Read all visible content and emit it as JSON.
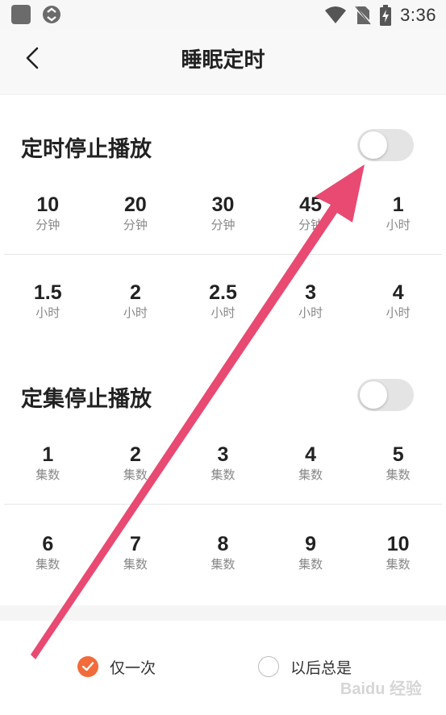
{
  "status_bar": {
    "time": "3:36"
  },
  "header": {
    "title": "睡眠定时"
  },
  "timer_section": {
    "title": "定时停止播放",
    "enabled": false,
    "rows": [
      [
        {
          "value": "10",
          "unit": "分钟"
        },
        {
          "value": "20",
          "unit": "分钟"
        },
        {
          "value": "30",
          "unit": "分钟"
        },
        {
          "value": "45",
          "unit": "分钟"
        },
        {
          "value": "1",
          "unit": "小时"
        }
      ],
      [
        {
          "value": "1.5",
          "unit": "小时"
        },
        {
          "value": "2",
          "unit": "小时"
        },
        {
          "value": "2.5",
          "unit": "小时"
        },
        {
          "value": "3",
          "unit": "小时"
        },
        {
          "value": "4",
          "unit": "小时"
        }
      ]
    ]
  },
  "episode_section": {
    "title": "定集停止播放",
    "enabled": false,
    "rows": [
      [
        {
          "value": "1",
          "unit": "集数"
        },
        {
          "value": "2",
          "unit": "集数"
        },
        {
          "value": "3",
          "unit": "集数"
        },
        {
          "value": "4",
          "unit": "集数"
        },
        {
          "value": "5",
          "unit": "集数"
        }
      ],
      [
        {
          "value": "6",
          "unit": "集数"
        },
        {
          "value": "7",
          "unit": "集数"
        },
        {
          "value": "8",
          "unit": "集数"
        },
        {
          "value": "9",
          "unit": "集数"
        },
        {
          "value": "10",
          "unit": "集数"
        }
      ]
    ]
  },
  "repeat_options": [
    {
      "label": "仅一次",
      "checked": true
    },
    {
      "label": "以后总是",
      "checked": false
    }
  ],
  "watermark": "Baidu 经验",
  "colors": {
    "accent": "#f26b3a",
    "annotation_arrow": "#e84a72"
  }
}
